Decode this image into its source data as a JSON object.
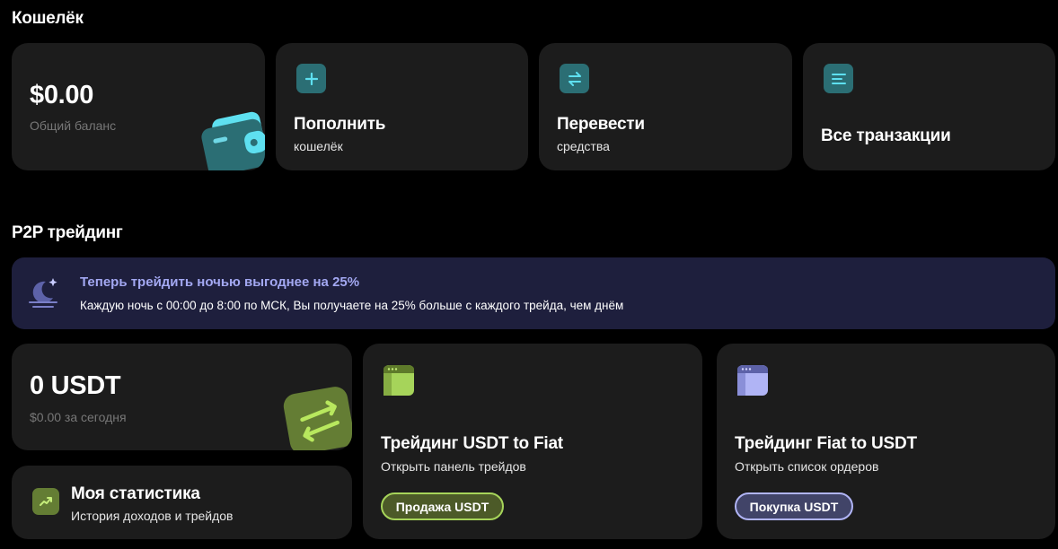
{
  "wallet": {
    "section_title": "Кошелёк",
    "balance": {
      "value": "$0.00",
      "label": "Общий баланс"
    },
    "topup": {
      "title": "Пополнить",
      "subtitle": "кошелёк",
      "icon": "plus-icon"
    },
    "transfer": {
      "title": "Перевести",
      "subtitle": "средства",
      "icon": "transfer-arrows-icon"
    },
    "transactions": {
      "title": "Все транзакции",
      "icon": "list-icon"
    }
  },
  "p2p": {
    "section_title": "P2P трейдинг",
    "promo": {
      "title": "Теперь трейдить ночью выгоднее на 25%",
      "text": "Каждую ночь с 00:00 до 8:00 по МСК, Вы получаете на 25% больше с каждого трейда, чем днём",
      "icon": "moon-icon"
    },
    "usdt_balance": {
      "value": "0 USDT",
      "label": "$0.00 за сегодня"
    },
    "stats": {
      "title": "Моя статистика",
      "subtitle": "История доходов и трейдов",
      "icon": "trend-up-icon"
    },
    "sell": {
      "title": "Трейдинг USDT to Fiat",
      "subtitle": "Открыть панель трейдов",
      "button": "Продажа USDT",
      "icon": "window-icon"
    },
    "buy": {
      "title": "Трейдинг Fiat to USDT",
      "subtitle": "Открыть список ордеров",
      "button": "Покупка USDT",
      "icon": "window-icon"
    }
  },
  "colors": {
    "background": "#000000",
    "card": "#1c1c1c",
    "teal_accent": "#2b6e74",
    "teal_icon": "#5ee0f0",
    "green_accent": "#a6d45a",
    "violet_accent": "#b0b4f5",
    "promo_bg": "#1e1f3d",
    "promo_title": "#a3a8f2"
  }
}
